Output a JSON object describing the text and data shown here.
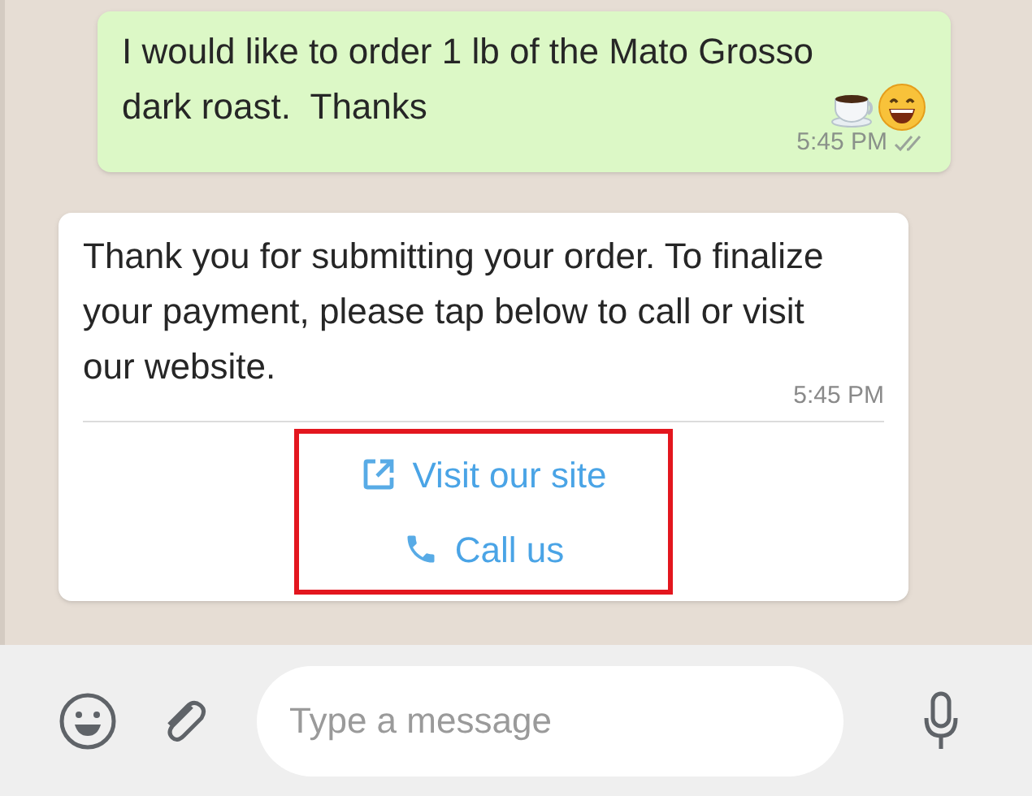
{
  "messages": [
    {
      "kind": "outgoing",
      "text": "I would like to order 1 lb of the Mato Grosso dark roast.  Thanks",
      "time": "5:45 PM"
    },
    {
      "kind": "incoming",
      "text": "Thank you for submitting your order. To finalize your payment, please tap below to call or visit our website.",
      "time": "5:45 PM",
      "buttons": [
        {
          "kind": "url",
          "label": "Visit our site"
        },
        {
          "kind": "phone",
          "label": "Call us"
        }
      ]
    }
  ],
  "composer": {
    "placeholder": "Type a message"
  }
}
